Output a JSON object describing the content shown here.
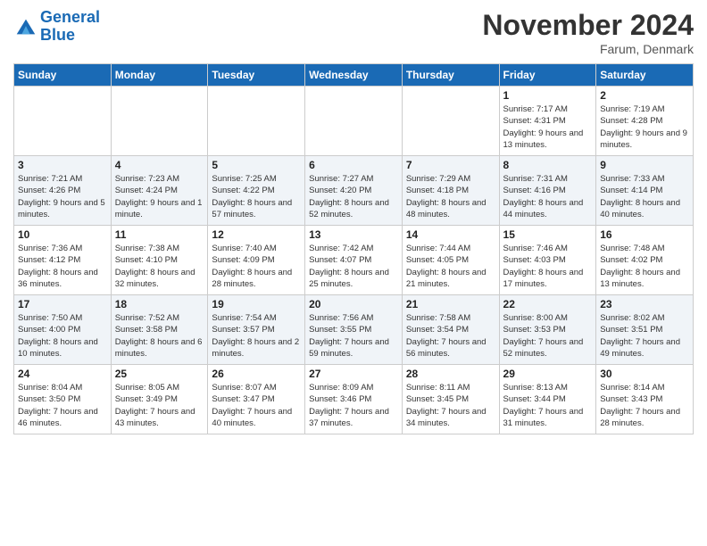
{
  "header": {
    "logo_line1": "General",
    "logo_line2": "Blue",
    "month_year": "November 2024",
    "location": "Farum, Denmark"
  },
  "weekdays": [
    "Sunday",
    "Monday",
    "Tuesday",
    "Wednesday",
    "Thursday",
    "Friday",
    "Saturday"
  ],
  "weeks": [
    [
      {
        "day": "",
        "info": ""
      },
      {
        "day": "",
        "info": ""
      },
      {
        "day": "",
        "info": ""
      },
      {
        "day": "",
        "info": ""
      },
      {
        "day": "",
        "info": ""
      },
      {
        "day": "1",
        "info": "Sunrise: 7:17 AM\nSunset: 4:31 PM\nDaylight: 9 hours\nand 13 minutes."
      },
      {
        "day": "2",
        "info": "Sunrise: 7:19 AM\nSunset: 4:28 PM\nDaylight: 9 hours\nand 9 minutes."
      }
    ],
    [
      {
        "day": "3",
        "info": "Sunrise: 7:21 AM\nSunset: 4:26 PM\nDaylight: 9 hours\nand 5 minutes."
      },
      {
        "day": "4",
        "info": "Sunrise: 7:23 AM\nSunset: 4:24 PM\nDaylight: 9 hours\nand 1 minute."
      },
      {
        "day": "5",
        "info": "Sunrise: 7:25 AM\nSunset: 4:22 PM\nDaylight: 8 hours\nand 57 minutes."
      },
      {
        "day": "6",
        "info": "Sunrise: 7:27 AM\nSunset: 4:20 PM\nDaylight: 8 hours\nand 52 minutes."
      },
      {
        "day": "7",
        "info": "Sunrise: 7:29 AM\nSunset: 4:18 PM\nDaylight: 8 hours\nand 48 minutes."
      },
      {
        "day": "8",
        "info": "Sunrise: 7:31 AM\nSunset: 4:16 PM\nDaylight: 8 hours\nand 44 minutes."
      },
      {
        "day": "9",
        "info": "Sunrise: 7:33 AM\nSunset: 4:14 PM\nDaylight: 8 hours\nand 40 minutes."
      }
    ],
    [
      {
        "day": "10",
        "info": "Sunrise: 7:36 AM\nSunset: 4:12 PM\nDaylight: 8 hours\nand 36 minutes."
      },
      {
        "day": "11",
        "info": "Sunrise: 7:38 AM\nSunset: 4:10 PM\nDaylight: 8 hours\nand 32 minutes."
      },
      {
        "day": "12",
        "info": "Sunrise: 7:40 AM\nSunset: 4:09 PM\nDaylight: 8 hours\nand 28 minutes."
      },
      {
        "day": "13",
        "info": "Sunrise: 7:42 AM\nSunset: 4:07 PM\nDaylight: 8 hours\nand 25 minutes."
      },
      {
        "day": "14",
        "info": "Sunrise: 7:44 AM\nSunset: 4:05 PM\nDaylight: 8 hours\nand 21 minutes."
      },
      {
        "day": "15",
        "info": "Sunrise: 7:46 AM\nSunset: 4:03 PM\nDaylight: 8 hours\nand 17 minutes."
      },
      {
        "day": "16",
        "info": "Sunrise: 7:48 AM\nSunset: 4:02 PM\nDaylight: 8 hours\nand 13 minutes."
      }
    ],
    [
      {
        "day": "17",
        "info": "Sunrise: 7:50 AM\nSunset: 4:00 PM\nDaylight: 8 hours\nand 10 minutes."
      },
      {
        "day": "18",
        "info": "Sunrise: 7:52 AM\nSunset: 3:58 PM\nDaylight: 8 hours\nand 6 minutes."
      },
      {
        "day": "19",
        "info": "Sunrise: 7:54 AM\nSunset: 3:57 PM\nDaylight: 8 hours\nand 2 minutes."
      },
      {
        "day": "20",
        "info": "Sunrise: 7:56 AM\nSunset: 3:55 PM\nDaylight: 7 hours\nand 59 minutes."
      },
      {
        "day": "21",
        "info": "Sunrise: 7:58 AM\nSunset: 3:54 PM\nDaylight: 7 hours\nand 56 minutes."
      },
      {
        "day": "22",
        "info": "Sunrise: 8:00 AM\nSunset: 3:53 PM\nDaylight: 7 hours\nand 52 minutes."
      },
      {
        "day": "23",
        "info": "Sunrise: 8:02 AM\nSunset: 3:51 PM\nDaylight: 7 hours\nand 49 minutes."
      }
    ],
    [
      {
        "day": "24",
        "info": "Sunrise: 8:04 AM\nSunset: 3:50 PM\nDaylight: 7 hours\nand 46 minutes."
      },
      {
        "day": "25",
        "info": "Sunrise: 8:05 AM\nSunset: 3:49 PM\nDaylight: 7 hours\nand 43 minutes."
      },
      {
        "day": "26",
        "info": "Sunrise: 8:07 AM\nSunset: 3:47 PM\nDaylight: 7 hours\nand 40 minutes."
      },
      {
        "day": "27",
        "info": "Sunrise: 8:09 AM\nSunset: 3:46 PM\nDaylight: 7 hours\nand 37 minutes."
      },
      {
        "day": "28",
        "info": "Sunrise: 8:11 AM\nSunset: 3:45 PM\nDaylight: 7 hours\nand 34 minutes."
      },
      {
        "day": "29",
        "info": "Sunrise: 8:13 AM\nSunset: 3:44 PM\nDaylight: 7 hours\nand 31 minutes."
      },
      {
        "day": "30",
        "info": "Sunrise: 8:14 AM\nSunset: 3:43 PM\nDaylight: 7 hours\nand 28 minutes."
      }
    ]
  ]
}
